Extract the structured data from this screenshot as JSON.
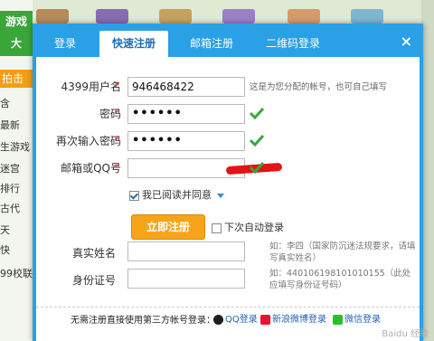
{
  "background": {
    "logo_lines": [
      "游戏",
      "大"
    ],
    "strip_labels": [
      "拍击",
      "含",
      "最新",
      "生游戏",
      "迷宫",
      "排行",
      "古代",
      "天",
      "快",
      "99校联"
    ]
  },
  "tabs": [
    "登录",
    "快速注册",
    "邮箱注册",
    "二维码登录"
  ],
  "close_label": "×",
  "form": {
    "username": {
      "label": "4399用户名",
      "value": "946468422",
      "hint": "这是为您分配的帐号，也可自己填写"
    },
    "password": {
      "label": "密码",
      "value": "••••••"
    },
    "password_confirm": {
      "label": "再次输入密码",
      "value": "••••••"
    },
    "email_qq": {
      "label": "邮箱或QQ号"
    },
    "agree_label": "我已阅读并同意",
    "register_button": "立即注册",
    "auto_login_label": "下次自动登录",
    "real_name": {
      "label": "真实姓名",
      "hint": "如：李四（国家防沉迷法规要求，请填写真实姓名）"
    },
    "id_number": {
      "label": "身份证号",
      "hint": "如：440106198101010155（此处应填写身份证号码）"
    }
  },
  "footer": {
    "prompt": "无需注册直接使用第三方帐号登录：",
    "qq": "QQ登录",
    "weibo": "新浪微博登录",
    "wechat": "微信登录"
  },
  "watermark": "Baidu 经验",
  "colors": {
    "tab_bar": "#2aa0e6",
    "button": "#f7a41b",
    "check": "#3aa63a",
    "required": "#e23b3b"
  }
}
